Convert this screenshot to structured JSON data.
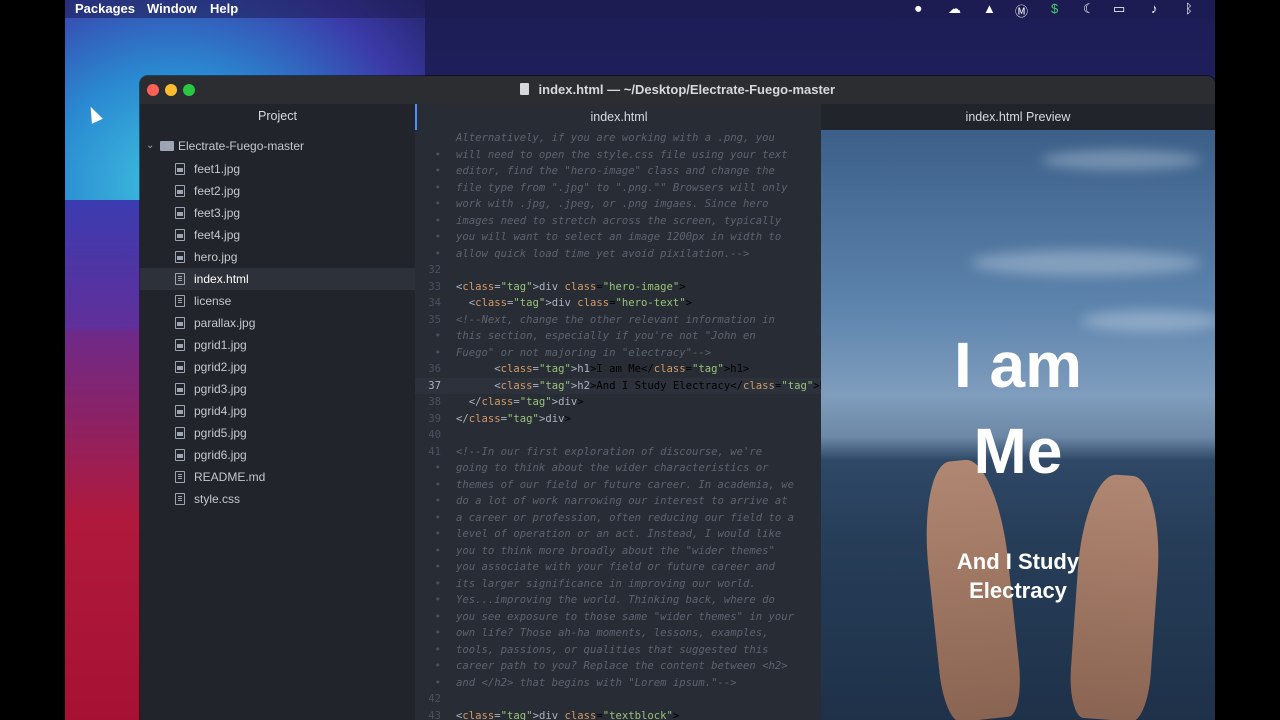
{
  "menubar": {
    "menus": [
      "Packages",
      "Window",
      "Help"
    ],
    "status_icons": [
      "record-icon",
      "creative-cloud-icon",
      "drive-icon",
      "malwarebytes-icon",
      "dollar-icon",
      "moon-icon",
      "battery-icon",
      "volume-icon",
      "bluetooth-icon"
    ]
  },
  "window": {
    "title": "index.html — ~/Desktop/Electrate-Fuego-master"
  },
  "tree": {
    "header": "Project",
    "root": "Electrate-Fuego-master",
    "items": [
      {
        "label": "feet1.jpg",
        "icon": "image-file-icon"
      },
      {
        "label": "feet2.jpg",
        "icon": "image-file-icon"
      },
      {
        "label": "feet3.jpg",
        "icon": "image-file-icon"
      },
      {
        "label": "feet4.jpg",
        "icon": "image-file-icon"
      },
      {
        "label": "hero.jpg",
        "icon": "image-file-icon"
      },
      {
        "label": "index.html",
        "icon": "text-file-icon"
      },
      {
        "label": "license",
        "icon": "text-file-icon"
      },
      {
        "label": "parallax.jpg",
        "icon": "image-file-icon"
      },
      {
        "label": "pgrid1.jpg",
        "icon": "image-file-icon"
      },
      {
        "label": "pgrid2.jpg",
        "icon": "image-file-icon"
      },
      {
        "label": "pgrid3.jpg",
        "icon": "image-file-icon"
      },
      {
        "label": "pgrid4.jpg",
        "icon": "image-file-icon"
      },
      {
        "label": "pgrid5.jpg",
        "icon": "image-file-icon"
      },
      {
        "label": "pgrid6.jpg",
        "icon": "image-file-icon"
      },
      {
        "label": "README.md",
        "icon": "markdown-file-icon"
      },
      {
        "label": "style.css",
        "icon": "text-file-icon"
      }
    ],
    "selected": "index.html"
  },
  "editor": {
    "tab": "index.html",
    "lines": [
      {
        "n": "",
        "text": "Alternatively, if you are working with a .png, you",
        "kind": "comment"
      },
      {
        "n": "•",
        "text": "will need to open the style.css file using your text",
        "kind": "comment"
      },
      {
        "n": "•",
        "text": "editor, find the \"hero-image\" class and change the",
        "kind": "comment"
      },
      {
        "n": "•",
        "text": "file type from \".jpg\" to \".png.\"\" Browsers will only",
        "kind": "comment"
      },
      {
        "n": "•",
        "text": "work with .jpg, .jpeg, or .png imgaes. Since hero",
        "kind": "comment"
      },
      {
        "n": "•",
        "text": "images need to stretch across the screen, typically",
        "kind": "comment"
      },
      {
        "n": "•",
        "text": "you will want to select an image 1200px in width to",
        "kind": "comment"
      },
      {
        "n": "•",
        "text": "allow quick load time yet avoid pixilation.-->",
        "kind": "comment"
      },
      {
        "n": "32",
        "text": "",
        "kind": "plain"
      },
      {
        "n": "33",
        "text": "<div class=\"hero-image\">",
        "kind": "tag"
      },
      {
        "n": "34",
        "text": "  <div class=\"hero-text\">",
        "kind": "tag"
      },
      {
        "n": "35",
        "text": "<!--Next, change the other relevant information in",
        "kind": "comment"
      },
      {
        "n": "•",
        "text": "this section, especially if you're not \"John en",
        "kind": "comment"
      },
      {
        "n": "•",
        "text": "Fuego\" or not majoring in \"electracy\"-->",
        "kind": "comment"
      },
      {
        "n": "36",
        "text": "      <h1>I am Me</h1>",
        "kind": "tag"
      },
      {
        "n": "37",
        "text": "      <h2>And I Study Electracy</h2>",
        "kind": "tag",
        "current": true
      },
      {
        "n": "38",
        "text": "  </div>",
        "kind": "tag"
      },
      {
        "n": "39",
        "text": "</div>",
        "kind": "tag"
      },
      {
        "n": "40",
        "text": "",
        "kind": "plain"
      },
      {
        "n": "41",
        "text": "<!--In our first exploration of discourse, we're",
        "kind": "comment"
      },
      {
        "n": "•",
        "text": "going to think about the wider characteristics or",
        "kind": "comment"
      },
      {
        "n": "•",
        "text": "themes of our field or future career. In academia, we",
        "kind": "comment"
      },
      {
        "n": "•",
        "text": "do a lot of work narrowing our interest to arrive at",
        "kind": "comment"
      },
      {
        "n": "•",
        "text": "a career or profession, often reducing our field to a",
        "kind": "comment"
      },
      {
        "n": "•",
        "text": "level of operation or an act. Instead, I would like",
        "kind": "comment"
      },
      {
        "n": "•",
        "text": "you to think more broadly about the \"wider themes\"",
        "kind": "comment"
      },
      {
        "n": "•",
        "text": "you associate with your field or future career and",
        "kind": "comment"
      },
      {
        "n": "•",
        "text": "its larger significance in improving our world.",
        "kind": "comment"
      },
      {
        "n": "•",
        "text": "Yes...improving the world. Thinking back, where do",
        "kind": "comment"
      },
      {
        "n": "•",
        "text": "you see exposure to those same \"wider themes\" in your",
        "kind": "comment"
      },
      {
        "n": "•",
        "text": "own life? Those ah-ha moments, lessons, examples,",
        "kind": "comment"
      },
      {
        "n": "•",
        "text": "tools, passions, or qualities that suggested this",
        "kind": "comment"
      },
      {
        "n": "•",
        "text": "career path to you? Replace the content between <h2>",
        "kind": "comment"
      },
      {
        "n": "•",
        "text": "and </h2> that begins with \"Lorem ipsum.\"-->",
        "kind": "comment"
      },
      {
        "n": "42",
        "text": "",
        "kind": "plain"
      },
      {
        "n": "43",
        "text": "<div class=\"textblock\">",
        "kind": "tag"
      }
    ]
  },
  "preview": {
    "tab": "index.html Preview",
    "h1_line1": "I am",
    "h1_line2": "Me",
    "h2_line1": "And I Study",
    "h2_line2": "Electracy"
  }
}
